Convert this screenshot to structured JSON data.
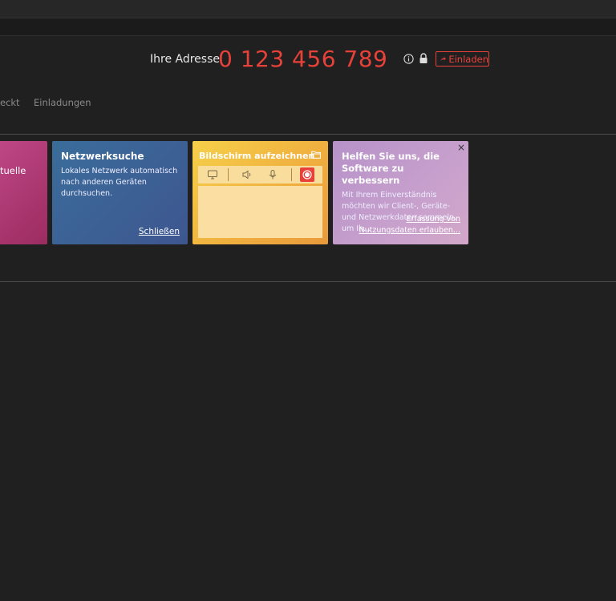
{
  "header": {
    "address_label": "Ihre Adresse",
    "address_number": "0 123 456 789",
    "invite_label": "Einladen"
  },
  "tabs": [
    {
      "label": "eckt"
    },
    {
      "label": "Einladungen"
    }
  ],
  "cards": {
    "pink": {
      "text_fragment": "tuelle"
    },
    "network": {
      "title": "Netzwerksuche",
      "text": "Lokales Netzwerk automatisch nach anderen Geräten durchsuchen.",
      "link": "Schließen"
    },
    "record": {
      "title": "Bildschirm aufzeichnen"
    },
    "help": {
      "title": "Helfen Sie uns, die Software zu verbessern",
      "text": "Mit Ihrem Einverständnis möchten wir Client-, Geräte- und Netzwerkdaten sammeln, um Ih...",
      "link": "Erfassung von Nutzungsdaten erlauben...",
      "close": "×"
    }
  },
  "colors": {
    "accent": "#e8413a",
    "background": "#202020"
  }
}
